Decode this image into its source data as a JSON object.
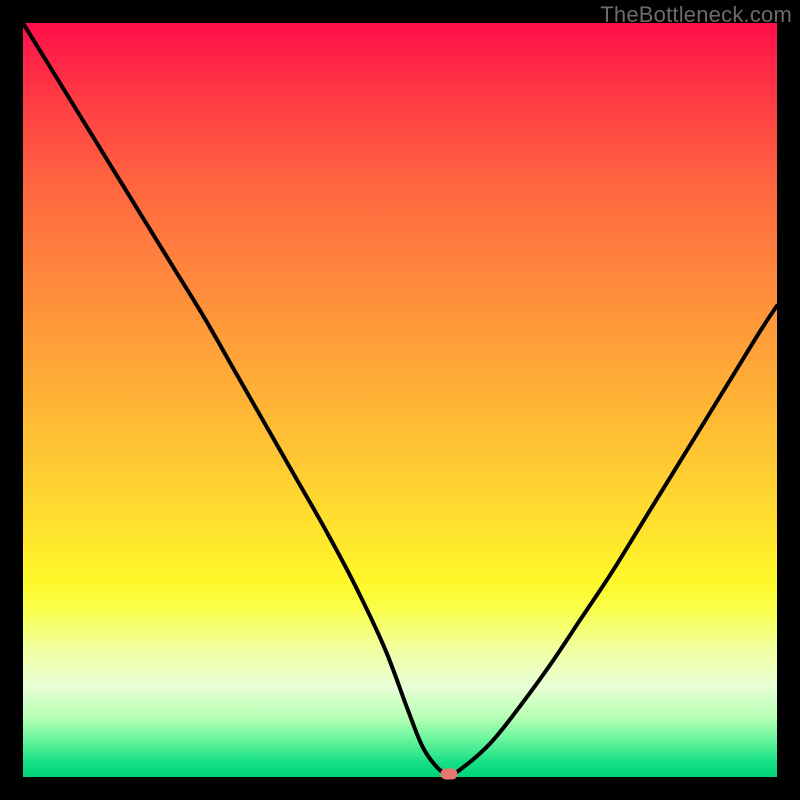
{
  "watermark": "TheBottleneck.com",
  "colors": {
    "frame": "#000000",
    "curve": "#000000",
    "marker": "#e4786f"
  },
  "chart_data": {
    "type": "line",
    "title": "",
    "xlabel": "",
    "ylabel": "",
    "xlim": [
      0,
      100
    ],
    "ylim": [
      0,
      100
    ],
    "grid": false,
    "series": [
      {
        "name": "bottleneck-curve",
        "x": [
          0,
          4,
          8,
          12,
          16,
          20,
          24,
          28,
          32,
          36,
          40,
          44,
          48,
          51,
          53,
          55,
          56.5,
          58,
          62,
          66,
          70,
          74,
          78,
          82,
          86,
          90,
          94,
          98,
          100
        ],
        "y": [
          100,
          93.5,
          87,
          80.5,
          74,
          67.5,
          61,
          54,
          47,
          40,
          33,
          25.5,
          17,
          9,
          4,
          1.2,
          0.4,
          1,
          4.5,
          9.5,
          15,
          21,
          27,
          33.5,
          40,
          46.5,
          53,
          59.5,
          62.5
        ]
      }
    ],
    "marker": {
      "x": 56.5,
      "y": 0.4
    },
    "gradient_stops": [
      {
        "pos": 0,
        "color": "#ff0e49"
      },
      {
        "pos": 50,
        "color": "#ffb636"
      },
      {
        "pos": 78,
        "color": "#fbff3c"
      },
      {
        "pos": 100,
        "color": "#00d37a"
      }
    ]
  }
}
